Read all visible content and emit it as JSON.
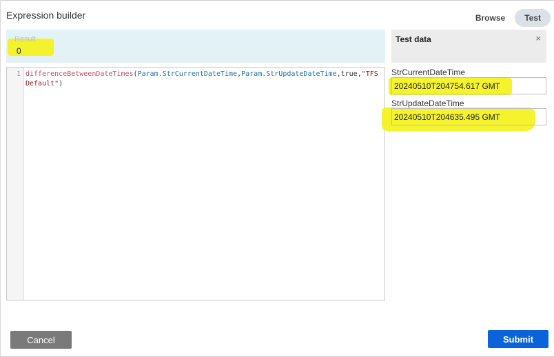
{
  "dialog": {
    "title": "Expression builder"
  },
  "tabs": {
    "browse_label": "Browse",
    "test_label": "Test"
  },
  "result": {
    "label": "Result",
    "value": "0"
  },
  "editor": {
    "line_number": "1",
    "tokens": {
      "fn": "differenceBetweenDateTimes",
      "open_paren": "(",
      "param1": "Param.StrCurrentDateTime",
      "comma1": ",",
      "param2": "Param.StrUpdateDateTime",
      "rest": ",true,",
      "string": "\"TFS Default\"",
      "close_paren": ")"
    }
  },
  "test_data": {
    "title": "Test data",
    "close_label": "×",
    "fields": [
      {
        "label": "StrCurrentDateTime",
        "value": "20240510T204754.617 GMT"
      },
      {
        "label": "StrUpdateDateTime",
        "value": "20240510T204635.495 GMT"
      }
    ]
  },
  "footer": {
    "cancel_label": "Cancel",
    "submit_label": "Submit"
  },
  "colors": {
    "highlight": "#f4f21a",
    "submit": "#0a63d9",
    "cancel": "#7a7a7a",
    "result_bg": "#e3f2f7"
  }
}
